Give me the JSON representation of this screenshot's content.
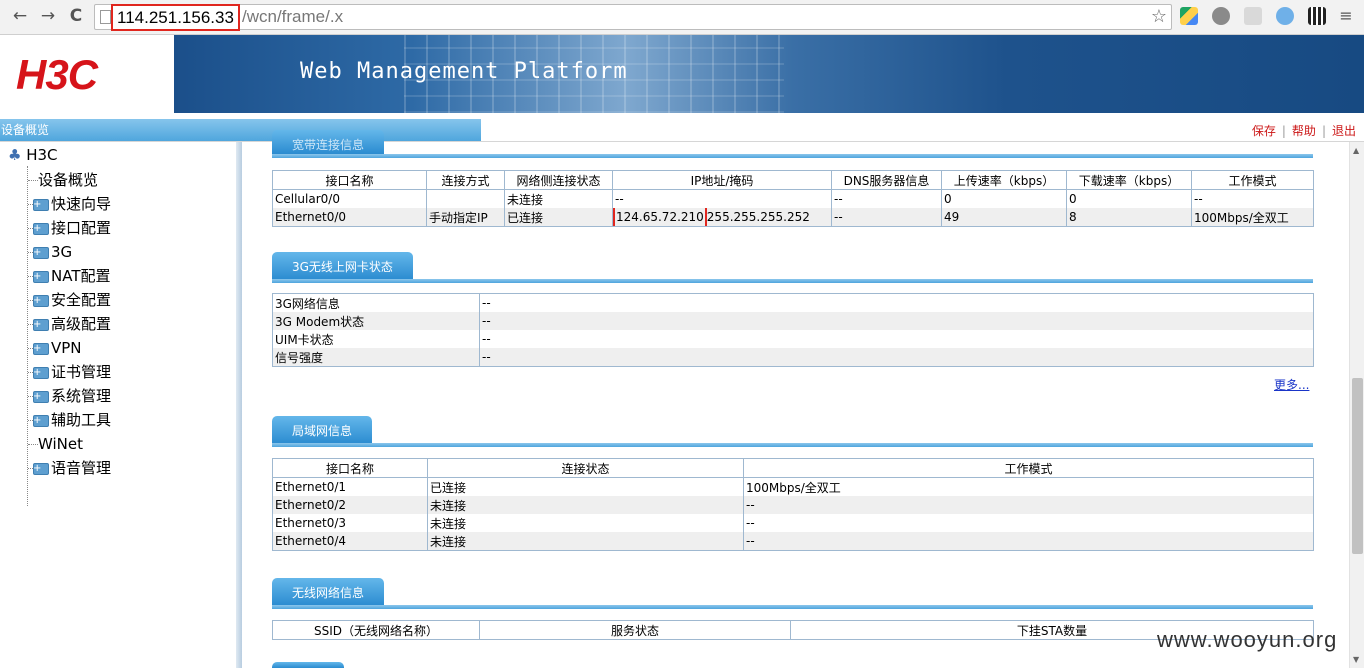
{
  "browser": {
    "url_host": "114.251.156.33",
    "url_path": "/wcn/frame/.x",
    "nav_back": "←",
    "nav_forward": "→",
    "nav_reload": "C",
    "star": "☆"
  },
  "header": {
    "logo": "H3C",
    "title": "Web Management Platform"
  },
  "subbar": {
    "breadcrumb": "设备概览",
    "links": {
      "save": "保存",
      "help": "帮助",
      "logout": "退出"
    }
  },
  "tree": {
    "root": "H3C",
    "items": [
      "设备概览",
      "快速向导",
      "接口配置",
      "3G",
      "NAT配置",
      "安全配置",
      "高级配置",
      "VPN",
      "证书管理",
      "系统管理",
      "辅助工具",
      "WiNet",
      "语音管理"
    ]
  },
  "broadband": {
    "tab": "宽带连接信息",
    "headers": [
      "接口名称",
      "连接方式",
      "网络侧连接状态",
      "IP地址/掩码",
      "DNS服务器信息",
      "上传速率（kbps）",
      "下载速率（kbps）",
      "工作模式"
    ],
    "rows": [
      {
        "iface": "Cellular0/0",
        "method": "",
        "status": "未连接",
        "ip": "--",
        "mask": "",
        "dns": "--",
        "up": "0",
        "down": "0",
        "mode": "--"
      },
      {
        "iface": "Ethernet0/0",
        "method": "手动指定IP",
        "status": "已连接",
        "ip": "124.65.72.210",
        "mask": "255.255.255.252",
        "dns": "--",
        "up": "49",
        "down": "8",
        "mode": "100Mbps/全双工"
      }
    ]
  },
  "g3": {
    "tab": "3G无线上网卡状态",
    "rows": [
      {
        "label": "3G网络信息",
        "value": "--"
      },
      {
        "label": "3G Modem状态",
        "value": "--"
      },
      {
        "label": "UIM卡状态",
        "value": "--"
      },
      {
        "label": "信号强度",
        "value": "--"
      }
    ],
    "more": "更多..."
  },
  "lan": {
    "tab": "局域网信息",
    "headers": [
      "接口名称",
      "连接状态",
      "工作模式"
    ],
    "rows": [
      {
        "iface": "Ethernet0/1",
        "status": "已连接",
        "mode": "100Mbps/全双工"
      },
      {
        "iface": "Ethernet0/2",
        "status": "未连接",
        "mode": "--"
      },
      {
        "iface": "Ethernet0/3",
        "status": "未连接",
        "mode": "--"
      },
      {
        "iface": "Ethernet0/4",
        "status": "未连接",
        "mode": "--"
      }
    ]
  },
  "wireless": {
    "tab": "无线网络信息",
    "headers": [
      "SSID（无线网络名称）",
      "服务状态",
      "下挂STA数量"
    ]
  },
  "watermark": "www.wooyun.org",
  "colors": {
    "accent": "#2a8bd0",
    "logo": "#d6141a",
    "highlight": "#e0261e"
  }
}
